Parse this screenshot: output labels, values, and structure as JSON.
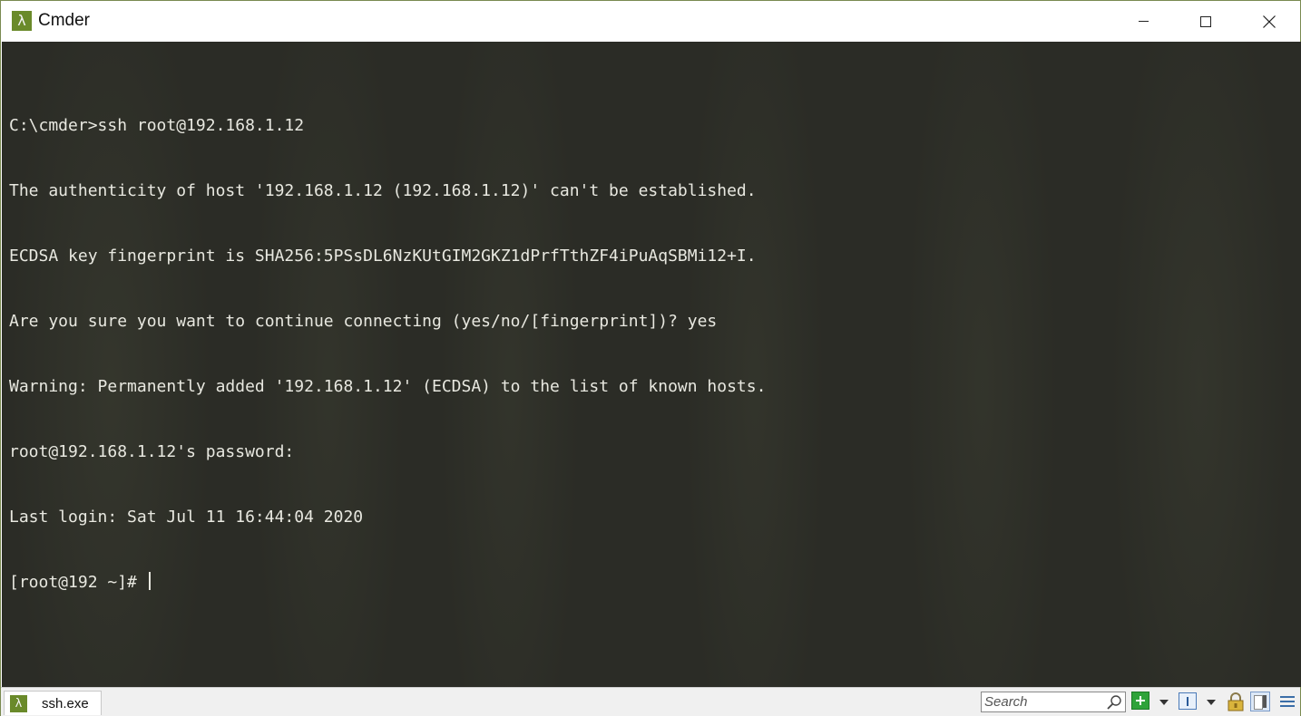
{
  "window": {
    "title": "Cmder",
    "app_icon_glyph": "λ",
    "controls": {
      "minimize": "minimize-icon",
      "maximize": "maximize-icon",
      "close": "close-icon"
    }
  },
  "terminal": {
    "lines": [
      "C:\\cmder>ssh root@192.168.1.12",
      "The authenticity of host '192.168.1.12 (192.168.1.12)' can't be established.",
      "ECDSA key fingerprint is SHA256:5PSsDL6NzKUtGIM2GKZ1dPrfTthZF4iPuAqSBMi12+I.",
      "Are you sure you want to continue connecting (yes/no/[fingerprint])? yes",
      "Warning: Permanently added '192.168.1.12' (ECDSA) to the list of known hosts.",
      "root@192.168.1.12's password:",
      "Last login: Sat Jul 11 16:44:04 2020",
      "[root@192 ~]# "
    ],
    "text_color": "#e8e8e0",
    "background_color": "#2b2c26"
  },
  "statusbar": {
    "tab": {
      "label": "ssh.exe",
      "icon_glyph": "λ"
    },
    "search": {
      "placeholder": "Search"
    },
    "tools": [
      "add-console-icon",
      "dropdown-arrow-icon",
      "split-view-icon",
      "dropdown-arrow-icon",
      "lock-icon",
      "panes-icon",
      "menu-icon"
    ]
  },
  "colors": {
    "accent": "#6a8a2a",
    "add_green": "#2fa33a",
    "menu_blue": "#3b6ea8"
  }
}
